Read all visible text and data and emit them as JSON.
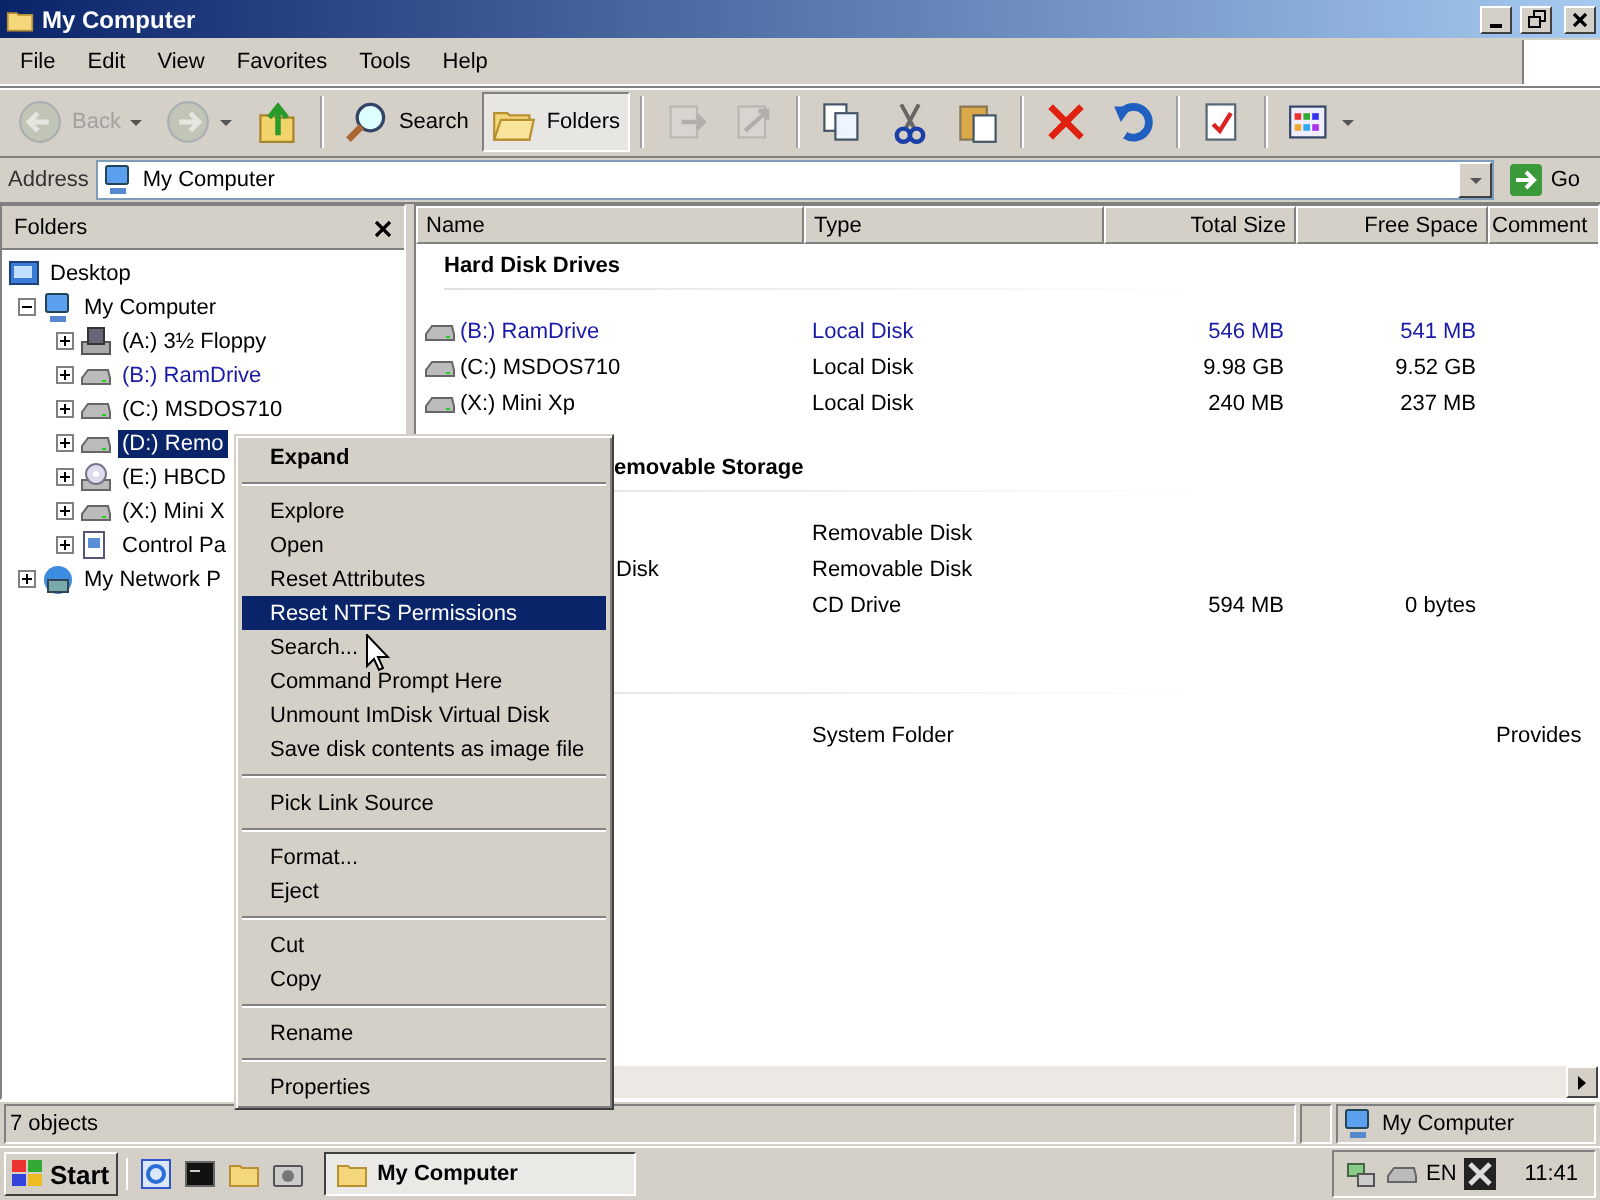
{
  "window": {
    "title": "My Computer"
  },
  "menu_bar": [
    "File",
    "Edit",
    "View",
    "Favorites",
    "Tools",
    "Help"
  ],
  "toolbar": [
    {
      "kind": "back",
      "label": "Back",
      "disabled": true,
      "selected": false
    },
    {
      "kind": "forward",
      "disabled": true,
      "selected": false
    },
    {
      "kind": "up",
      "disabled": false,
      "selected": false
    },
    {
      "kind": "separator"
    },
    {
      "kind": "search",
      "label": "Search",
      "disabled": false,
      "selected": false
    },
    {
      "kind": "folders",
      "label": "Folders",
      "disabled": false,
      "selected": true
    },
    {
      "kind": "separator"
    },
    {
      "kind": "move-to",
      "disabled": true,
      "selected": false
    },
    {
      "kind": "copy-to",
      "disabled": true,
      "selected": false
    },
    {
      "kind": "separator"
    },
    {
      "kind": "copy",
      "disabled": false,
      "selected": false
    },
    {
      "kind": "cut",
      "disabled": false,
      "selected": false
    },
    {
      "kind": "paste",
      "disabled": false,
      "selected": false
    },
    {
      "kind": "separator"
    },
    {
      "kind": "delete",
      "disabled": false,
      "selected": false
    },
    {
      "kind": "undo",
      "disabled": false,
      "selected": false
    },
    {
      "kind": "separator"
    },
    {
      "kind": "properties",
      "disabled": false,
      "selected": false
    },
    {
      "kind": "separator"
    },
    {
      "kind": "views",
      "disabled": false,
      "selected": false
    }
  ],
  "address": {
    "label": "Address",
    "value": "My Computer",
    "go": "Go"
  },
  "folders_pane": {
    "title": "Folders",
    "tree": [
      {
        "label": "Desktop",
        "kind": "desktop",
        "selected": false,
        "compressed": false,
        "children": [
          {
            "label": "My Computer",
            "kind": "computer",
            "expanded": true,
            "selected": false,
            "compressed": false,
            "children": [
              {
                "label": "(A:) 3½ Floppy",
                "kind": "floppy",
                "expanded": false,
                "selected": false,
                "compressed": false
              },
              {
                "label": "(B:) RamDrive",
                "kind": "drive",
                "expanded": false,
                "selected": false,
                "compressed": true
              },
              {
                "label": "(C:) MSDOS710",
                "kind": "drive",
                "expanded": false,
                "selected": false,
                "compressed": false
              },
              {
                "label": "(D:) Remo",
                "kind": "drive",
                "expanded": false,
                "selected": true,
                "compressed": false
              },
              {
                "label": "(E:) HBCD",
                "kind": "cd",
                "expanded": false,
                "selected": false,
                "compressed": false
              },
              {
                "label": "(X:) Mini X",
                "kind": "drive",
                "expanded": false,
                "selected": false,
                "compressed": false
              },
              {
                "label": "Control Pa",
                "kind": "control-panel",
                "expanded": false,
                "selected": false,
                "compressed": false
              }
            ]
          },
          {
            "label": "My Network P",
            "kind": "network",
            "expanded": false,
            "selected": false,
            "compressed": false
          }
        ]
      }
    ]
  },
  "file_list": {
    "columns": [
      "Name",
      "Type",
      "Total Size",
      "Free Space",
      "Comment"
    ],
    "groups": [
      {
        "title": "Hard Disk Drives",
        "clipped": false,
        "rows": [
          {
            "kind": "drive",
            "name": "(B:) RamDrive",
            "type": "Local Disk",
            "total_size": "546 MB",
            "free_space": "541 MB",
            "compressed": true
          },
          {
            "kind": "drive",
            "name": "(C:) MSDOS710",
            "type": "Local Disk",
            "total_size": "9.98 GB",
            "free_space": "9.52 GB",
            "compressed": false
          },
          {
            "kind": "drive",
            "name": "(X:) Mini Xp",
            "type": "Local Disk",
            "total_size": "240 MB",
            "free_space": "237 MB",
            "compressed": false
          }
        ]
      },
      {
        "title": "emovable Storage",
        "clipped": true,
        "rows": [
          {
            "type": "Removable Disk",
            "compressed": false
          },
          {
            "name": "Disk",
            "clipped": true,
            "type": "Removable Disk",
            "compressed": false
          },
          {
            "type": "CD Drive",
            "total_size": "594 MB",
            "free_space": "0 bytes",
            "compressed": false
          }
        ]
      },
      {
        "clipped": true,
        "rows": [
          {
            "type": "System Folder",
            "comment": "Provides",
            "compressed": false
          }
        ]
      }
    ]
  },
  "context_menu": [
    {
      "kind": "item",
      "label": "Expand",
      "default": true,
      "selected": false
    },
    {
      "kind": "separator"
    },
    {
      "kind": "item",
      "label": "Explore",
      "default": false,
      "selected": false
    },
    {
      "kind": "item",
      "label": "Open",
      "default": false,
      "selected": false
    },
    {
      "kind": "item",
      "label": "Reset Attributes",
      "default": false,
      "selected": false
    },
    {
      "kind": "item",
      "label": "Reset NTFS Permissions",
      "default": false,
      "selected": true
    },
    {
      "kind": "item",
      "label": "Search...",
      "default": false,
      "selected": false
    },
    {
      "kind": "item",
      "label": "Command Prompt Here",
      "default": false,
      "selected": false
    },
    {
      "kind": "item",
      "label": "Unmount ImDisk Virtual Disk",
      "default": false,
      "selected": false
    },
    {
      "kind": "item",
      "label": "Save disk contents as image file",
      "default": false,
      "selected": false
    },
    {
      "kind": "separator"
    },
    {
      "kind": "item",
      "label": "Pick Link Source",
      "default": false,
      "selected": false
    },
    {
      "kind": "separator"
    },
    {
      "kind": "item",
      "label": "Format...",
      "default": false,
      "selected": false
    },
    {
      "kind": "item",
      "label": "Eject",
      "default": false,
      "selected": false
    },
    {
      "kind": "separator"
    },
    {
      "kind": "item",
      "label": "Cut",
      "default": false,
      "selected": false
    },
    {
      "kind": "item",
      "label": "Copy",
      "default": false,
      "selected": false
    },
    {
      "kind": "separator"
    },
    {
      "kind": "item",
      "label": "Rename",
      "default": false,
      "selected": false
    },
    {
      "kind": "separator"
    },
    {
      "kind": "item",
      "label": "Properties",
      "default": false,
      "selected": false
    }
  ],
  "status_bar": {
    "text": "7 objects",
    "location": "My Computer"
  },
  "taskbar": {
    "start": "Start",
    "quick_launch": [
      {
        "kind": "browser"
      },
      {
        "kind": "console"
      },
      {
        "kind": "folder"
      },
      {
        "kind": "camera"
      }
    ],
    "tasks": [
      {
        "label": "My Computer",
        "selected": true
      }
    ],
    "tray": {
      "language": "EN",
      "clock": "11:41"
    }
  }
}
